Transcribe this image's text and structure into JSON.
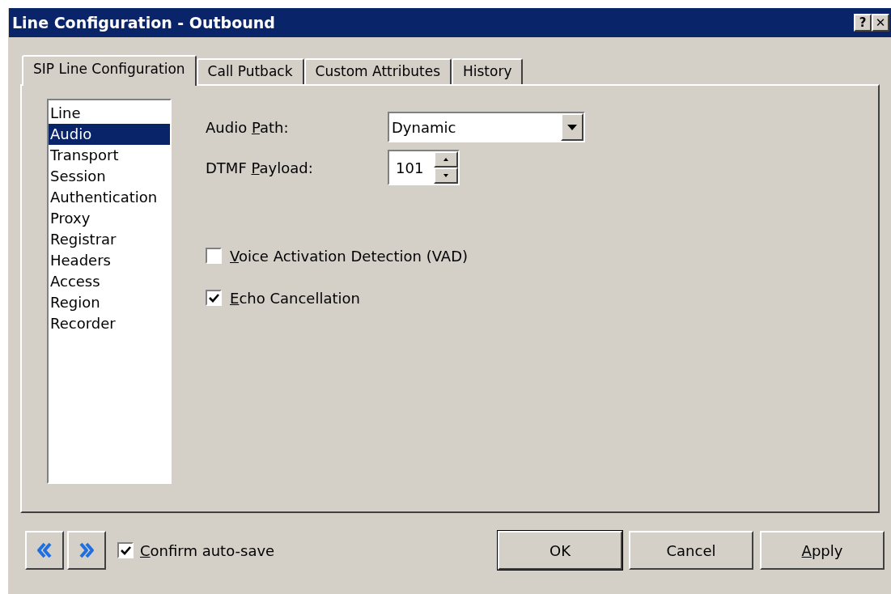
{
  "window": {
    "title": "Line Configuration - Outbound",
    "title_buttons": [
      "?",
      "✕"
    ]
  },
  "tabs": [
    {
      "label": "SIP Line Configuration",
      "selected": true
    },
    {
      "label": "Call Putback",
      "selected": false
    },
    {
      "label": "Custom Attributes",
      "selected": false
    },
    {
      "label": "History",
      "selected": false
    }
  ],
  "sections": [
    {
      "label": "Line",
      "selected": false
    },
    {
      "label": "Audio",
      "selected": true
    },
    {
      "label": "Transport",
      "selected": false
    },
    {
      "label": "Session",
      "selected": false
    },
    {
      "label": "Authentication",
      "selected": false
    },
    {
      "label": "Proxy",
      "selected": false
    },
    {
      "label": "Registrar",
      "selected": false
    },
    {
      "label": "Headers",
      "selected": false
    },
    {
      "label": "Access",
      "selected": false
    },
    {
      "label": "Region",
      "selected": false
    },
    {
      "label": "Recorder",
      "selected": false
    }
  ],
  "fields": [
    {
      "kind": "dropdown",
      "label_start": "Audio ",
      "access_key": "P",
      "label_end": "ath:",
      "value": "Dynamic"
    },
    {
      "kind": "spinner",
      "label_start": "DTMF ",
      "access_key": "P",
      "label_end": "ayload:",
      "value": "101"
    }
  ],
  "options": [
    {
      "access_key": "V",
      "label_end": "oice Activation Detection (VAD)",
      "checked": false
    },
    {
      "access_key": "E",
      "label_end": "cho Cancellation",
      "checked": true
    }
  ],
  "footer": {
    "confirm": {
      "access_key": "C",
      "label_end": "onfirm auto-save",
      "checked": true
    },
    "buttons": [
      {
        "label_end": "OK",
        "default": true
      },
      {
        "label_end": "Cancel",
        "default": false
      },
      {
        "access_key": "A",
        "label_end": "pply",
        "default": false
      }
    ]
  }
}
